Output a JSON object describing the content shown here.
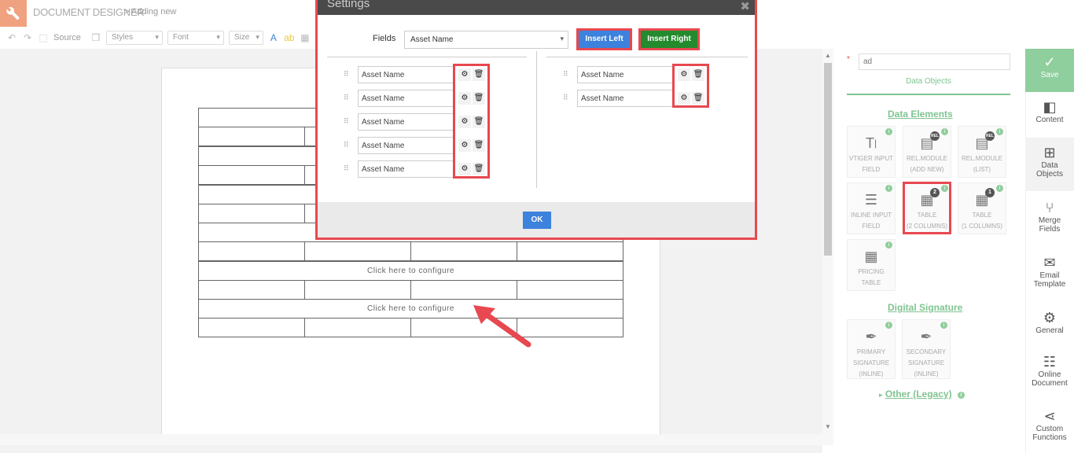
{
  "header": {
    "title": "DOCUMENT DESIGNER",
    "breadcrumb_sep": ">",
    "subtitle": "Adding new"
  },
  "toolbar": {
    "source_label": "Source",
    "styles_label": "Styles",
    "font_label": "Font",
    "size_label": "Size"
  },
  "canvas": {
    "configure_text": "Click here to configure"
  },
  "modal": {
    "title": "Settings",
    "fields_label": "Fields",
    "fields_selected": "Asset Name",
    "insert_left_label": "Insert Left",
    "insert_right_label": "Insert Right",
    "left_fields": [
      "Asset Name",
      "Asset Name",
      "Asset Name",
      "Asset Name",
      "Asset Name"
    ],
    "right_fields": [
      "Asset Name",
      "Asset Name"
    ],
    "ok_label": "OK"
  },
  "right_panel": {
    "search_value": "ad",
    "tab_label": "Data Objects",
    "data_elements_title": "Data Elements",
    "tiles": {
      "vtiger_l1": "VTIGER INPUT",
      "vtiger_l2": "FIELD",
      "relnew_l1": "REL.MODULE",
      "relnew_l2": "(ADD NEW)",
      "rellist_l1": "REL.MODULE",
      "rellist_l2": "(LIST)",
      "inline_l1": "INLINE INPUT",
      "inline_l2": "FIELD",
      "table2_l1": "TABLE",
      "table2_l2": "(2 COLUMNS)",
      "table2_badge": "2",
      "table1_l1": "TABLE",
      "table1_l2": "(1 COLUMNS)",
      "table1_badge": "1",
      "pricing_l1": "PRICING TABLE",
      "rel_badge": "REL",
      "primary_l1": "PRIMARY",
      "primary_l2": "SIGNATURE",
      "primary_l3": "(INLINE)",
      "secondary_l1": "SECONDARY",
      "secondary_l2": "SIGNATURE",
      "secondary_l3": "(INLINE)"
    },
    "digital_signature_title": "Digital Signature",
    "other_legacy_title": "Other (Legacy)"
  },
  "sidebar": {
    "save": "Save",
    "content": "Content",
    "data_objects_l1": "Data",
    "data_objects_l2": "Objects",
    "merge_fields_l1": "Merge",
    "merge_fields_l2": "Fields",
    "email_template_l1": "Email",
    "email_template_l2": "Template",
    "general": "General",
    "online_document_l1": "Online",
    "online_document_l2": "Document",
    "custom_functions_l1": "Custom",
    "custom_functions_l2": "Functions"
  },
  "colors": {
    "accent_red": "#e84850",
    "insert_left_blue": "#3d82dc",
    "insert_right_green": "#238a2d",
    "panel_green": "#8fce9d"
  }
}
